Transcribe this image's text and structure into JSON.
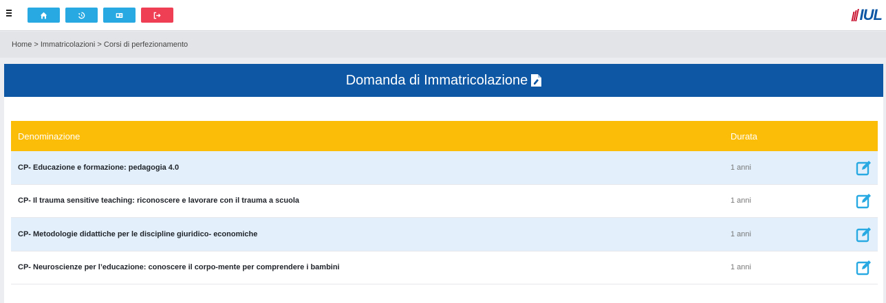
{
  "toolbar": {
    "menu_icon": "hamburger-icon",
    "buttons": [
      {
        "icon": "home-icon",
        "color": "#28a9e1"
      },
      {
        "icon": "history-icon",
        "color": "#28a9e1"
      },
      {
        "icon": "id-card-icon",
        "color": "#28a9e1"
      },
      {
        "icon": "logout-icon",
        "color": "#ef3f55"
      }
    ],
    "logo_text": "IUL"
  },
  "breadcrumb": {
    "text": "Home > Immatricolazioni > Corsi di perfezionamento"
  },
  "card": {
    "title": "Domanda di Immatricolazione",
    "title_icon": "file-signature-icon"
  },
  "table": {
    "headers": {
      "name": "Denominazione",
      "duration": "Durata"
    },
    "rows": [
      {
        "name": "CP- Educazione e formazione: pedagogia 4.0",
        "duration": "1 anni",
        "action_icon": "edit-icon"
      },
      {
        "name": "CP- Il trauma sensitive teaching: riconoscere e lavorare con il trauma a scuola",
        "duration": "1 anni",
        "action_icon": "edit-icon"
      },
      {
        "name": "CP- Metodologie didattiche per le discipline giuridico- economiche",
        "duration": "1 anni",
        "action_icon": "edit-icon"
      },
      {
        "name": "CP- Neuroscienze per l’educazione: conoscere il corpo-mente per comprendere i bambini",
        "duration": "1 anni",
        "action_icon": "edit-icon"
      }
    ]
  },
  "colors": {
    "header_blue": "#0d57a5",
    "table_header_yellow": "#fbbd08",
    "row_highlight": "#e3f0fb",
    "accent_light_blue": "#28a9e1",
    "logout_red": "#ef3f55"
  }
}
